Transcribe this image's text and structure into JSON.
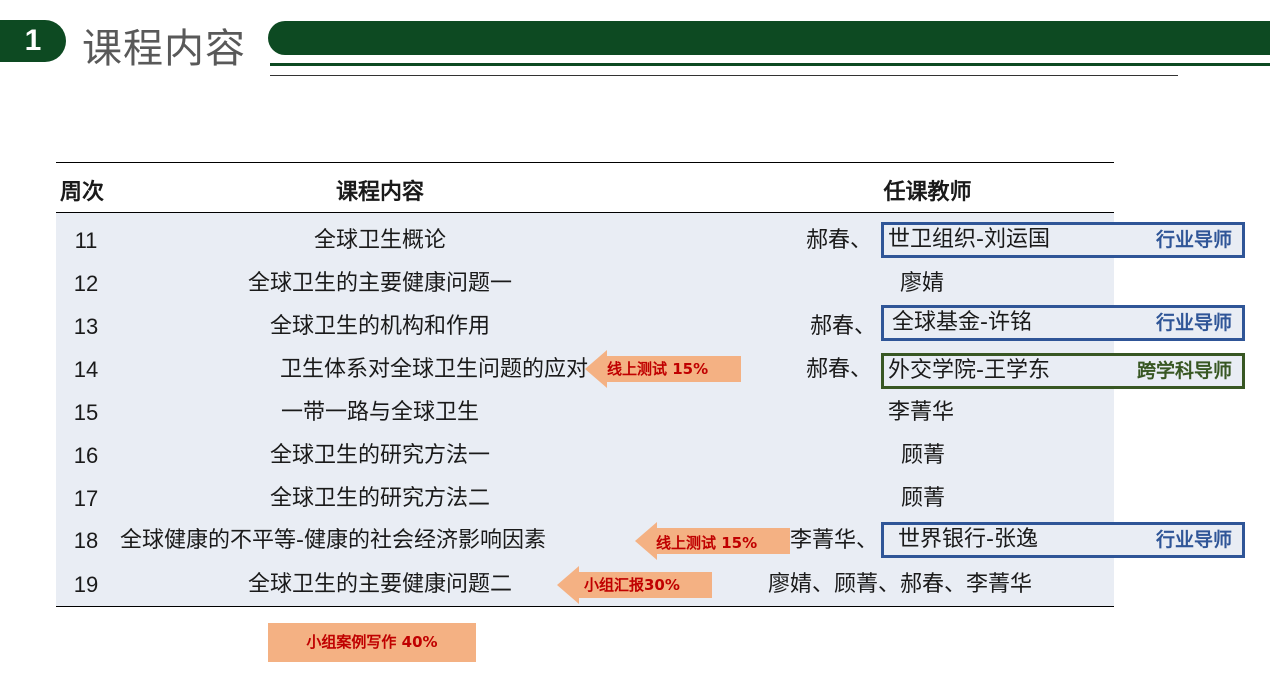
{
  "header": {
    "number": "1",
    "title": "课程内容"
  },
  "table": {
    "headers": {
      "week": "周次",
      "content": "课程内容",
      "teacher": "任课教师"
    },
    "rows": [
      {
        "week": "11",
        "content": "全球卫生概论",
        "teacher": "郝春、"
      },
      {
        "week": "12",
        "content": "全球卫生的主要健康问题一",
        "teacher": "廖婧"
      },
      {
        "week": "13",
        "content": "全球卫生的机构和作用",
        "teacher": "郝春、"
      },
      {
        "week": "14",
        "content": "卫生体系对全球卫生问题的应对",
        "teacher": "郝春、"
      },
      {
        "week": "15",
        "content": "一带一路与全球卫生",
        "teacher": "李菁华"
      },
      {
        "week": "16",
        "content": "全球卫生的研究方法一",
        "teacher": "顾菁"
      },
      {
        "week": "17",
        "content": "全球卫生的研究方法二",
        "teacher": "顾菁"
      },
      {
        "week": "18",
        "content": "全球健康的不平等-健康的社会经济影响因素",
        "teacher": "李菁华、"
      },
      {
        "week": "19",
        "content": "全球卫生的主要健康问题二",
        "teacher": "廖婧、顾菁、郝春、李菁华"
      }
    ]
  },
  "mentors": [
    {
      "name": "世卫组织-刘运国",
      "role": "行业导师"
    },
    {
      "name": "全球基金-许铭",
      "role": "行业导师"
    },
    {
      "name": "外交学院-王学东",
      "role": "跨学科导师"
    },
    {
      "name": "世界银行-张逸",
      "role": "行业导师"
    }
  ],
  "assessments": {
    "test1": "线上测试  15%",
    "test2": "线上测试  15%",
    "group_report": "小组汇报30%",
    "group_writing": "小组案例写作  40%"
  },
  "colors": {
    "brand_green": "#0d4a22",
    "box_blue": "#2f5597",
    "box_green": "#385723",
    "arrow_orange": "#f4b183",
    "arrow_text_red": "#c00000",
    "table_bg": "#e9edf4"
  }
}
